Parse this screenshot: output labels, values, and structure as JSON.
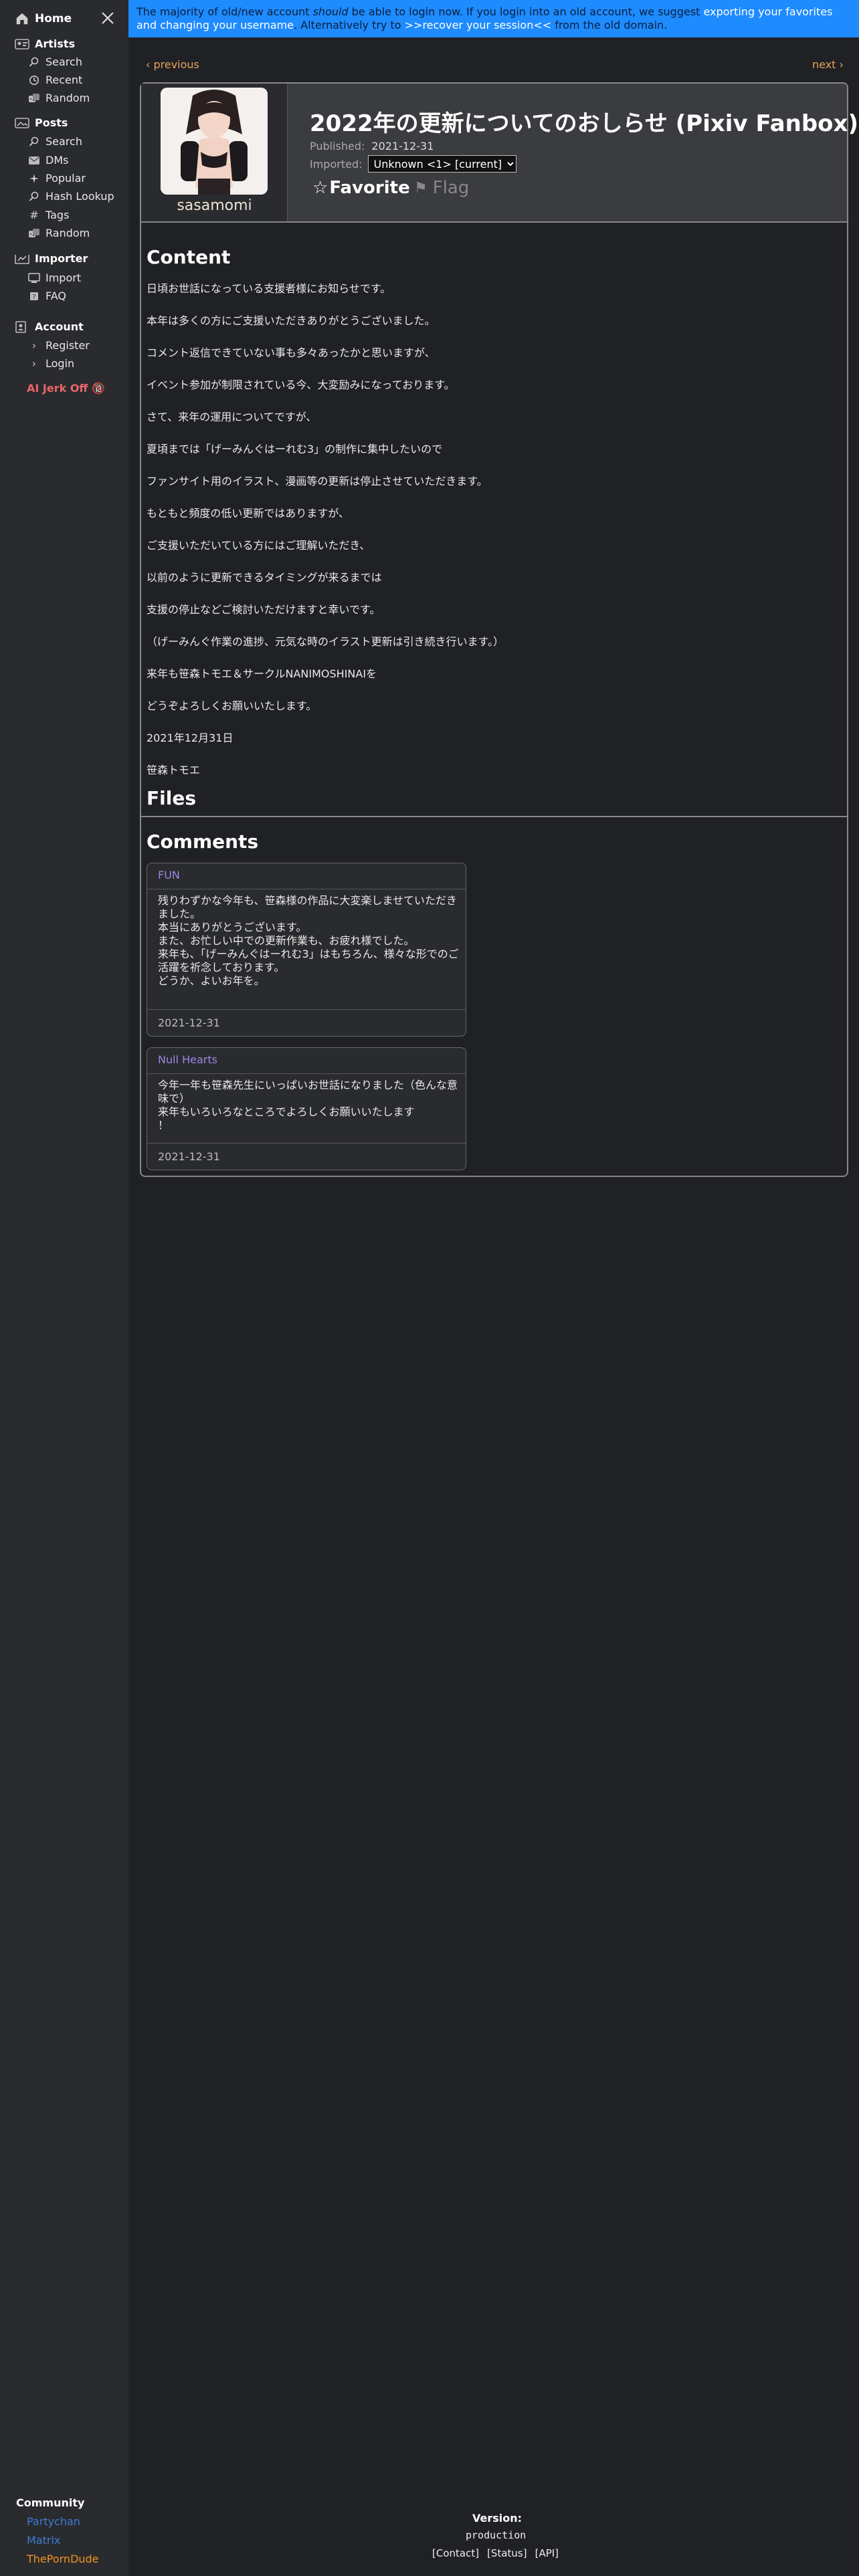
{
  "sidebar": {
    "home": "Home",
    "sections": [
      {
        "title": "Artists",
        "items": [
          "Search",
          "Recent",
          "Random"
        ]
      },
      {
        "title": "Posts",
        "items": [
          "Search",
          "DMs",
          "Popular",
          "Hash Lookup",
          "Tags",
          "Random"
        ]
      },
      {
        "title": "Importer",
        "items": [
          "Import",
          "FAQ"
        ]
      },
      {
        "title": "Account",
        "items": [
          "Register",
          "Login"
        ]
      }
    ],
    "ai_link": "AI Jerk Off 🔞",
    "community": {
      "title": "Community",
      "links": [
        {
          "label": "Partychan",
          "color": "#3d7bd6"
        },
        {
          "label": "Matrix",
          "color": "#3d7bd6"
        },
        {
          "label": "ThePornDude",
          "color": "#f29322"
        }
      ]
    }
  },
  "banner": {
    "t1": "The majority of old/new account ",
    "t2": "should",
    "t3": " be able to login now. If you login into an old account, we suggest ",
    "l1": "exporting your favorites and changing your username",
    "t4": ". Alternatively try to ",
    "l2": ">>recover your session<<",
    "t5": " from the old domain."
  },
  "nav": {
    "previous": "‹ previous",
    "next": "next ›"
  },
  "post": {
    "artist": "sasamomi",
    "title": "2022年の更新についてのおしらせ (Pixiv Fanbox)",
    "published_label": "Published:",
    "published_value": "2021-12-31",
    "imported_label": "Imported:",
    "imported_option": "Unknown <1> [current]",
    "favorite": "Favorite",
    "flag": "Flag"
  },
  "content": {
    "heading": "Content",
    "paragraphs": [
      "日頃お世話になっている支援者様にお知らせです。",
      "本年は多くの方にご支援いただきありがとうございました。",
      "コメント返信できていない事も多々あったかと思いますが、",
      "イベント参加が制限されている今、大変励みになっております。",
      "さて、来年の運用についてですが、",
      "夏頃までは「げーみんぐはーれむ3」の制作に集中したいので",
      "ファンサイト用のイラスト、漫画等の更新は停止させていただきます。",
      "もともと頻度の低い更新ではありますが、",
      "ご支援いただいている方にはご理解いただき、",
      "以前のように更新できるタイミングが来るまでは",
      "支援の停止などご検討いただけますと幸いです。",
      "（げーみんぐ作業の進捗、元気な時のイラスト更新は引き続き行います。）",
      "来年も笹森トモエ＆サークルNANIMOSHINAIを",
      "どうぞよろしくお願いいたします。",
      "2021年12月31日",
      "笹森トモエ"
    ]
  },
  "files": {
    "heading": "Files"
  },
  "comments": {
    "heading": "Comments",
    "items": [
      {
        "author": "FUN",
        "lines": [
          "残りわずかな今年も、笹森様の作品に大変楽しませていただき",
          "ました。",
          "本当にありがとうございます。",
          "また、お忙しい中での更新作業も、お疲れ様でした。",
          "来年も、「げーみんぐはーれむ3」はもちろん、様々な形でのご",
          "活躍を祈念しております。",
          "どうか、よいお年を。"
        ],
        "date": "2021-12-31"
      },
      {
        "author": "Null Hearts",
        "lines": [
          "今年一年も笹森先生にいっぱいお世話になりました（色んな意",
          "味で）",
          "来年もいろいろなところでよろしくお願いいたします",
          "！"
        ],
        "date": "2021-12-31"
      }
    ]
  },
  "footer": {
    "version_label": "Version:",
    "version_value": "production",
    "links": [
      "[Contact]",
      "[Status]",
      "[API]"
    ]
  }
}
